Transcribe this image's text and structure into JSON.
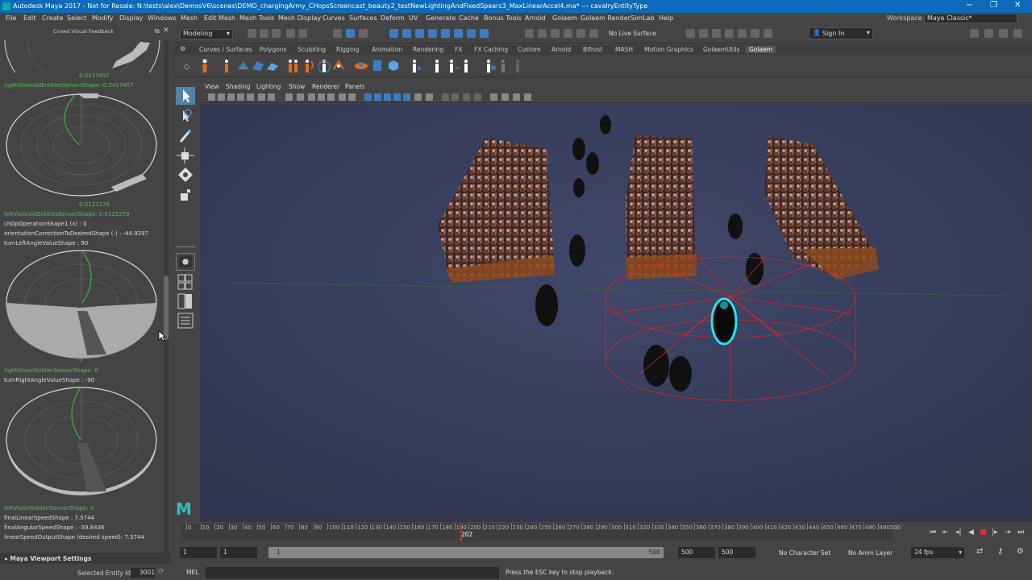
{
  "window": {
    "title": "Autodesk Maya 2017 - Not for Resale: N:\\tests\\alex\\DemosV6\\scenes\\DEMO_chargingArmy_CHopsScreencast_beauty2_testNewLightingAndFixedSpears3_MaxLinearAccel4.ma* --- cavalryEntityType",
    "minimize": "−",
    "maximize": "❐",
    "close": "✕"
  },
  "menu": [
    "File",
    "Edit",
    "Create",
    "Select",
    "Modify",
    "Display",
    "Windows",
    "Mesh",
    "Edit Mesh",
    "Mesh Tools",
    "Mesh Display",
    "Curves",
    "Surfaces",
    "Deform",
    "UV",
    "Generate",
    "Cache",
    "Bonus Tools",
    "Arnold",
    "Golaem",
    "Golaem Render",
    "SimLab",
    "Help"
  ],
  "workspace": {
    "label": "Workspace :",
    "value": "Maya Classic*"
  },
  "statusline": {
    "mode": "Modeling",
    "live_surface": "No Live Surface",
    "sign_in": "Sign In"
  },
  "shelf_tabs": [
    "Curves / Surfaces",
    "Polygons",
    "Sculpting",
    "Rigging",
    "Animation",
    "Rendering",
    "FX",
    "FX Caching",
    "Custom",
    "Arnold",
    "Bifrost",
    "MASH",
    "Motion Graphics",
    "GolaemUtils",
    "Golaem"
  ],
  "active_shelf": "Golaem",
  "left_panel": {
    "header": "Crowd Visual Feedback",
    "value_top": "0.0417457",
    "right_vision_all": "rightVisionAllEntitiesSensorShape: 0.0417457",
    "value_mid": "0.0121279",
    "left_vision_all": "leftVisionAllEntitiesSensorShape: 0.0121279",
    "ch_op": "chOpOperationShape1 (x) : 0",
    "orientation": "orientationCorrectionToDesiredShape (-) : -44.9297",
    "turn_left": "turnLeftAngleValueShape : 90",
    "value_zero_1": "0",
    "right_vision_soldier": "rightVisionSoldierSensorShape: 0",
    "turn_right": "turnRightAngleValueShape : -90",
    "left_vision_soldier": "leftVisionSoldierSensorShape: 0",
    "final_linear": "finalLinearSpeedShape : 7.5744",
    "final_angular": "finalAngularSpeedShape : -39.8436",
    "linear_output": "linearSpeedOutputShape  (desired speed): 7.5744"
  },
  "viewport_settings": "Maya Viewport Settings",
  "entity": {
    "label": "Selected Entity Id:",
    "value": "3001"
  },
  "panel_menu": [
    "View",
    "Shading",
    "Lighting",
    "Show",
    "Renderer",
    "Panels"
  ],
  "timeline": {
    "ticks": [
      "0",
      "10",
      "20",
      "30",
      "40",
      "50",
      "60",
      "70",
      "80",
      "90",
      "100",
      "110",
      "120",
      "130",
      "140",
      "150",
      "160",
      "170",
      "180",
      "190",
      "200",
      "210",
      "220",
      "230",
      "240",
      "250",
      "260",
      "270",
      "280",
      "290",
      "300",
      "310",
      "320",
      "330",
      "340",
      "350",
      "360",
      "370",
      "380",
      "390",
      "400",
      "410",
      "420",
      "430",
      "440",
      "450",
      "460",
      "470",
      "480",
      "490500"
    ],
    "current_frame": "202",
    "frame_field": "1"
  },
  "range": {
    "start": "1",
    "start_inner": "1",
    "slider_start": "1",
    "slider_end": "500",
    "end_inner": "500",
    "end": "500",
    "character_set": "No Character Set",
    "anim_layer": "No Anim Layer",
    "fps": "24 fps"
  },
  "cmdline": {
    "label": "MEL",
    "help": "Press the ESC key to stop playback."
  }
}
